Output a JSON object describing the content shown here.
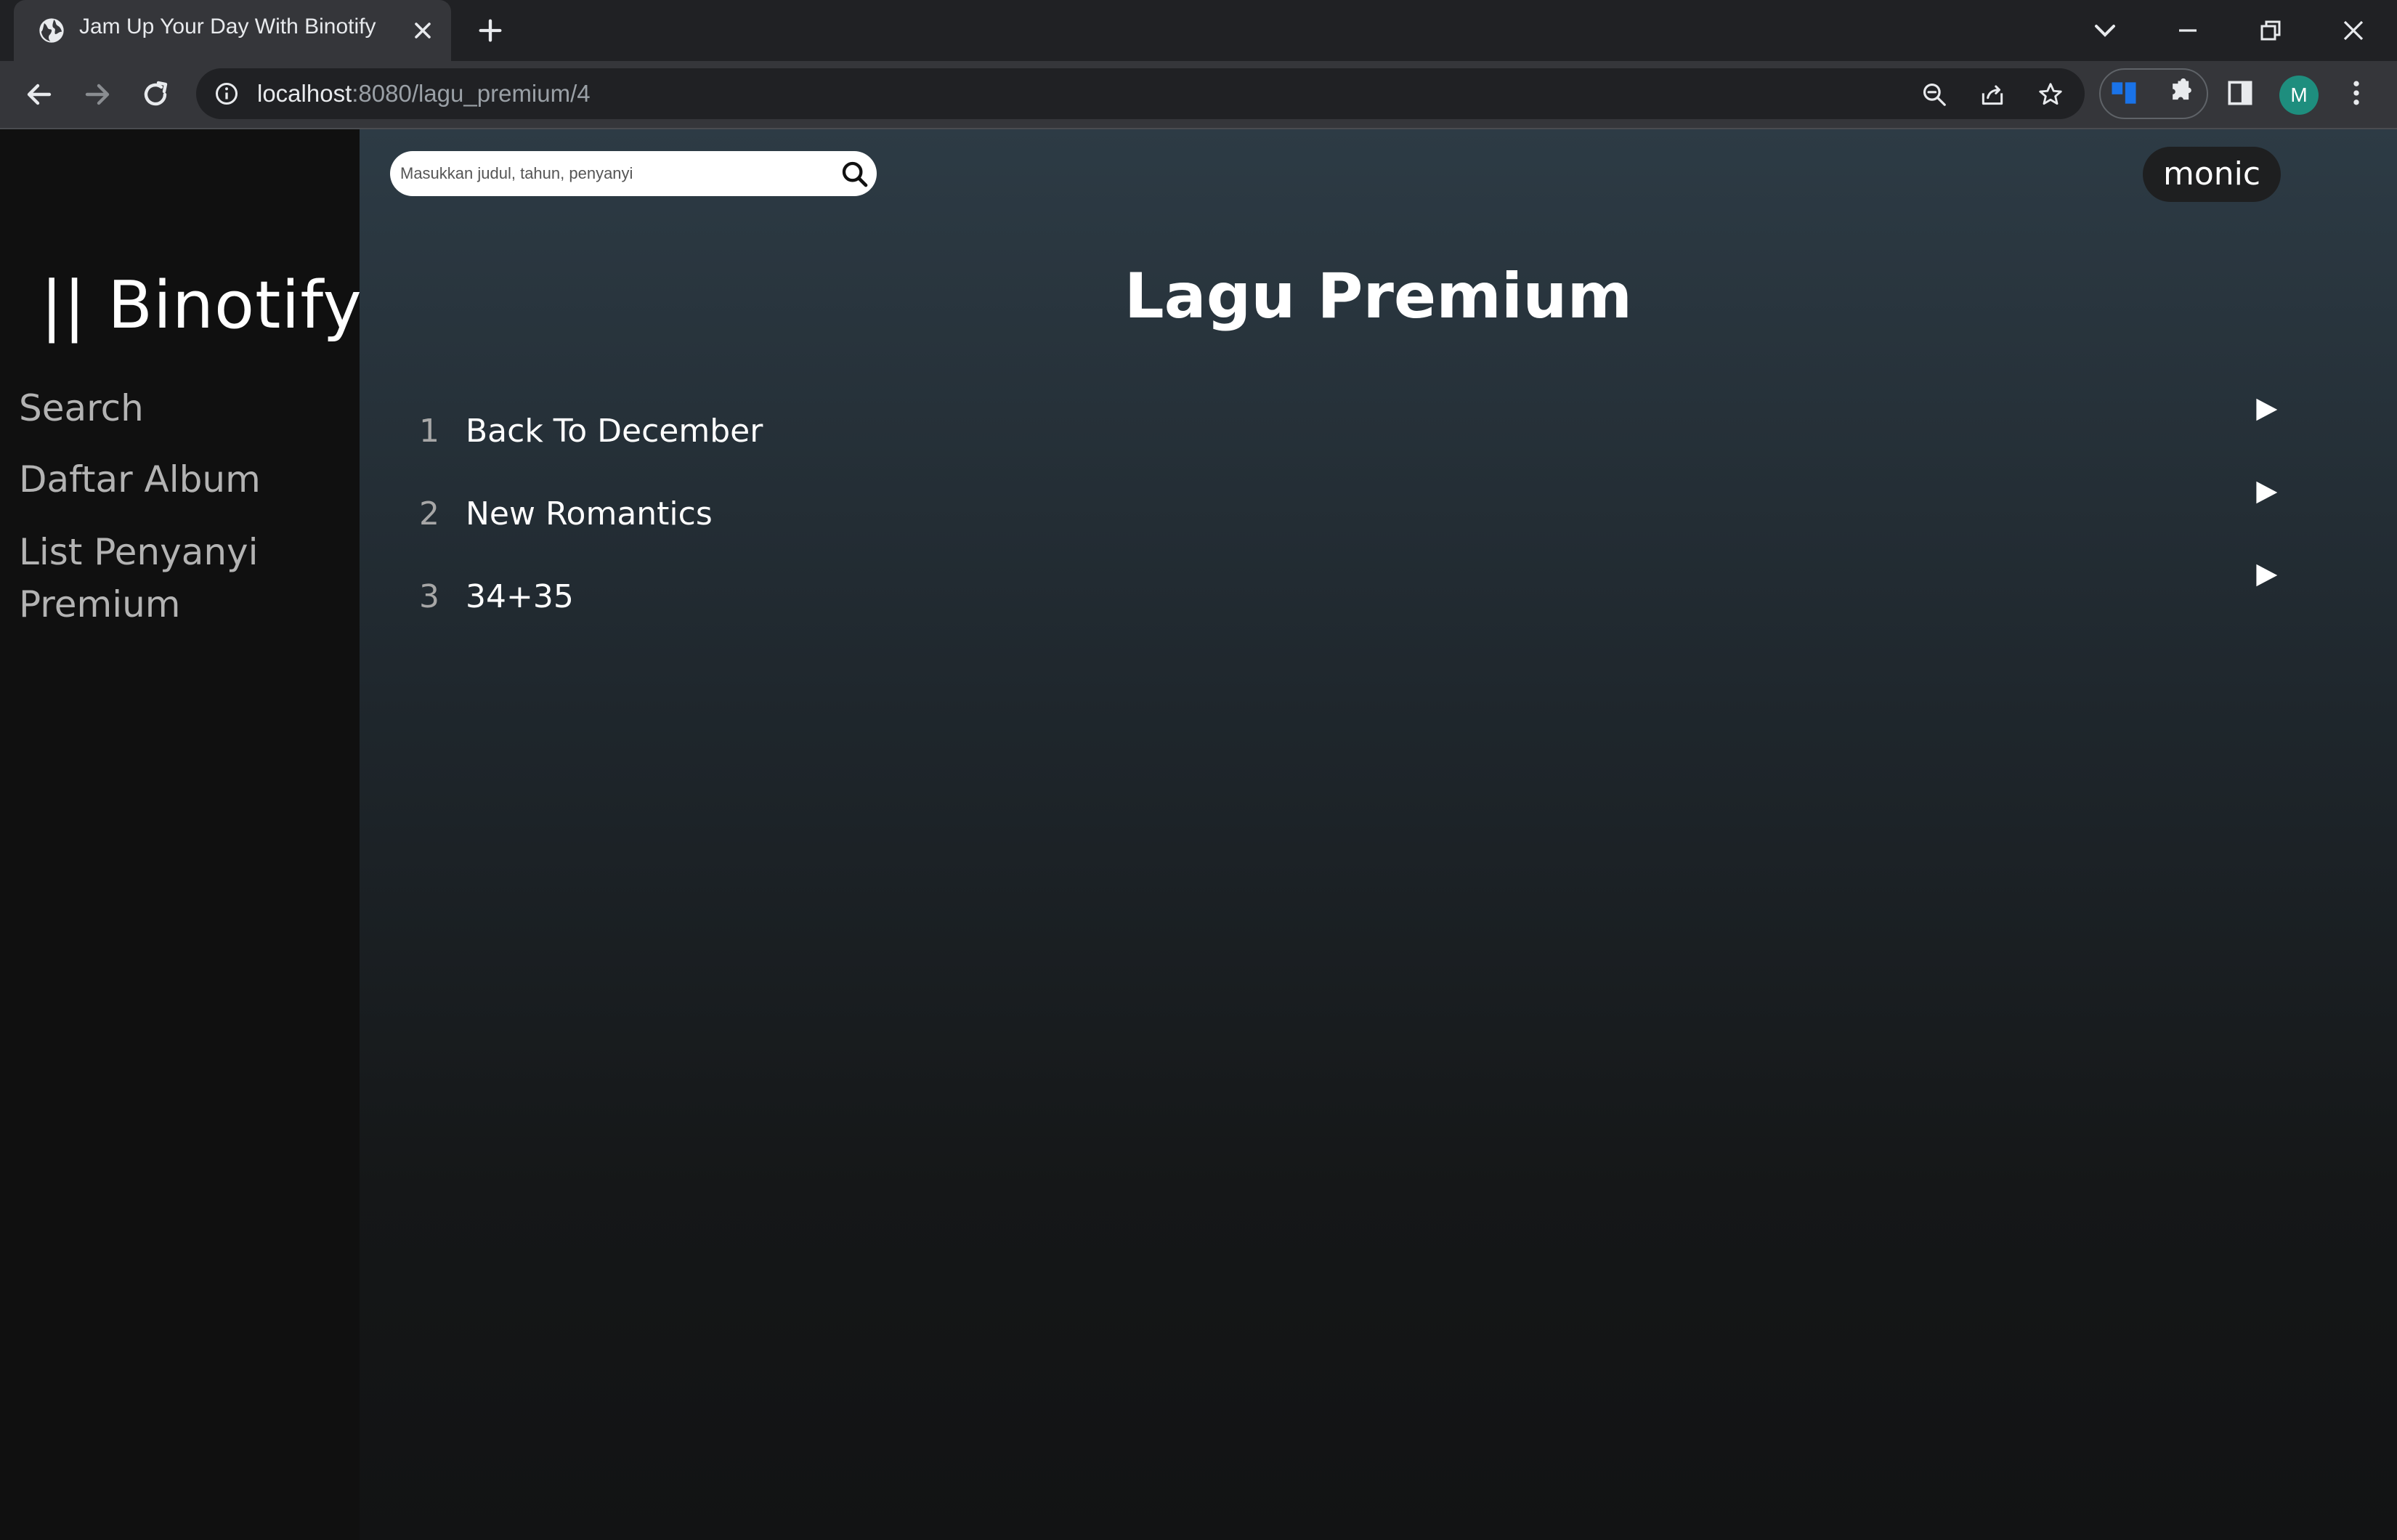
{
  "browser": {
    "tab_title": "Jam Up Your Day With Binotify",
    "url_host": "localhost",
    "url_path": ":8080/lagu_premium/4",
    "profile_initial": "M"
  },
  "sidebar": {
    "logo": "|| Binotify",
    "links": [
      {
        "label": "Search"
      },
      {
        "label": "Daftar Album"
      },
      {
        "label": "List Penyanyi Premium"
      }
    ]
  },
  "header": {
    "search_placeholder": "Masukkan judul, tahun, penyanyi",
    "username": "monic"
  },
  "main": {
    "title": "Lagu Premium",
    "songs": [
      {
        "number": "1",
        "title": "Back To December"
      },
      {
        "number": "2",
        "title": "New Romantics"
      },
      {
        "number": "3",
        "title": "34+35"
      }
    ]
  }
}
